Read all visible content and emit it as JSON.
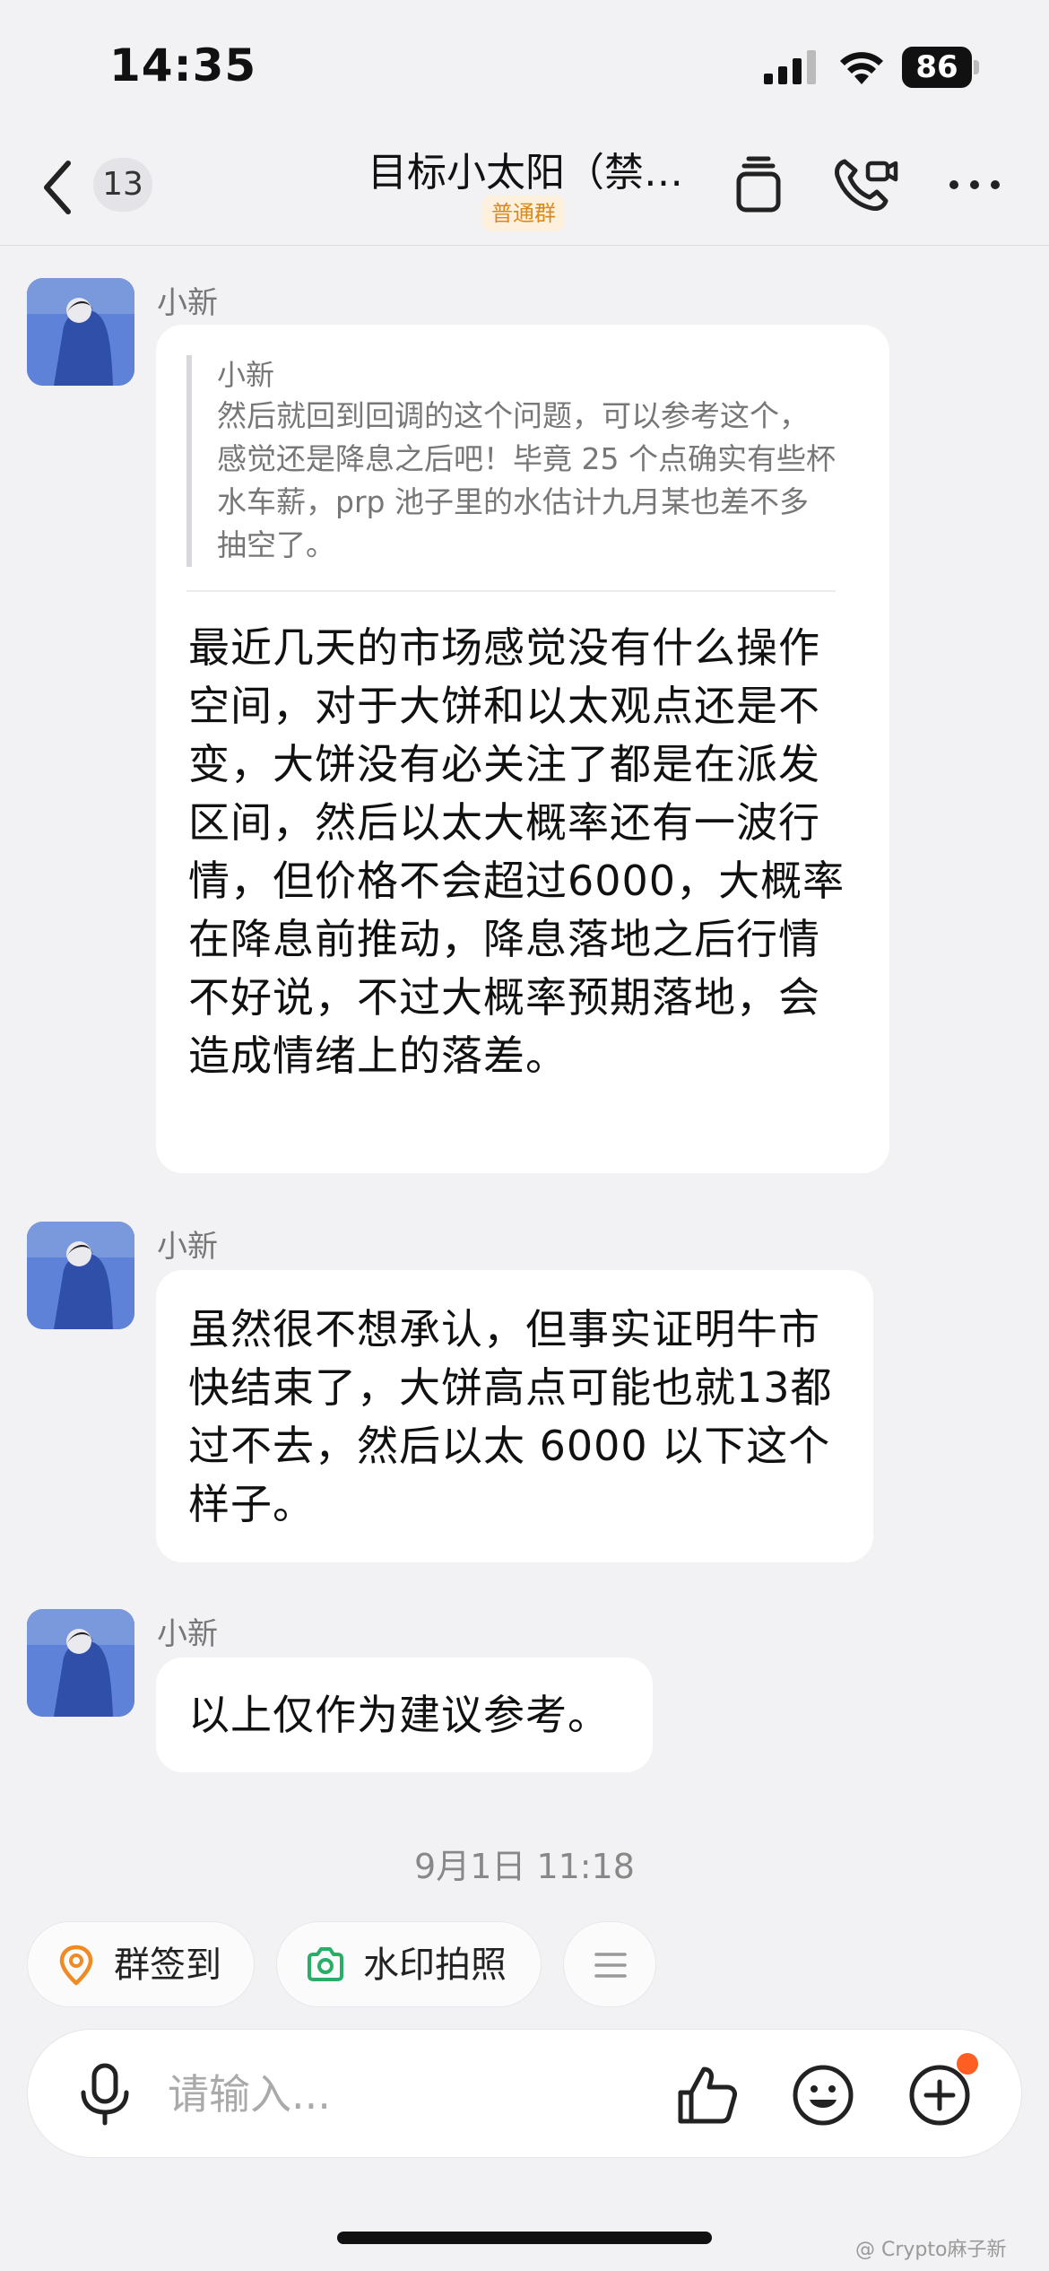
{
  "status_bar": {
    "time": "14:35",
    "battery": "86"
  },
  "nav": {
    "unread_count": "13",
    "title": "目标小太阳（禁…",
    "group_tag": "普通群"
  },
  "messages": [
    {
      "sender": "小新",
      "quote": {
        "sender": "小新",
        "text": "然后就回到回调的这个问题，可以参考这个，感觉还是降息之后吧！毕竟 25 个点确实有些杯水车薪，prp 池子里的水估计九月某也差不多抽空了。"
      },
      "text": "最近几天的市场感觉没有什么操作空间，对于大饼和以太观点还是不变，大饼没有必关注了都是在派发区间，然后以太大概率还有一波行情，但价格不会超过6000，大概率在降息前推动，降息落地之后行情不好说，不过大概率预期落地，会造成情绪上的落差。"
    },
    {
      "sender": "小新",
      "text": "虽然很不想承认，但事实证明牛市快结束了，大饼高点可能也就13都过不去，然后以太 6000 以下这个样子。"
    },
    {
      "sender": "小新",
      "text": "以上仅作为建议参考。"
    }
  ],
  "timestamp": "9月1日 11:18",
  "quick_actions": [
    {
      "label": "群签到",
      "icon": "location-pin-icon"
    },
    {
      "label": "水印拍照",
      "icon": "camera-icon"
    },
    {
      "label": "",
      "icon": "menu-icon"
    }
  ],
  "input": {
    "placeholder": "请输入..."
  },
  "watermark": "@ Crypto麻子新",
  "colors": {
    "accent_orange": "#ff5e22",
    "camera_green": "#2aae67",
    "tag_orange": "#d88b1c"
  }
}
